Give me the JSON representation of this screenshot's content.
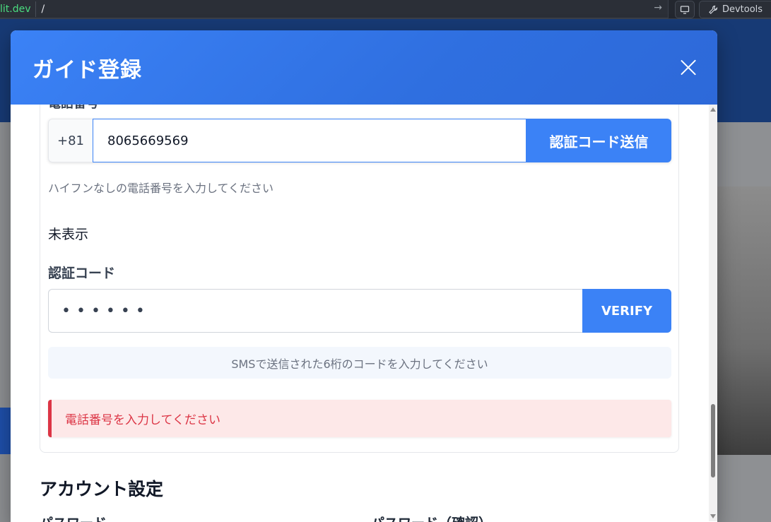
{
  "browser": {
    "url_host": "lit.dev",
    "url_path": "/",
    "devtools_label": "Devtools"
  },
  "modal": {
    "title": "ガイド登録",
    "phone": {
      "label": "電話番号",
      "country_code": "+81",
      "value": "8065669569",
      "send_button": "認証コード送信",
      "hint": "ハイフンなしの電話番号を入力してください"
    },
    "status_text": "未表示",
    "verification": {
      "label": "認証コード",
      "masked_value": "••••••",
      "verify_button": "VERIFY",
      "info": "SMSで送信された6桁のコードを入力してください"
    },
    "error_message": "電話番号を入力してください",
    "account_section": {
      "title": "アカウント設定",
      "password_label": "パスワード",
      "password_confirm_label": "パスワード（確認）"
    }
  },
  "colors": {
    "primary": "#3b82f6",
    "error": "#dc3545",
    "error_bg": "#fde8e8"
  }
}
